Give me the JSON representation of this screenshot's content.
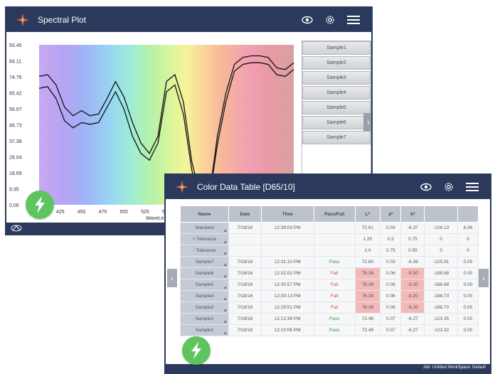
{
  "spectral_window": {
    "title": "Spectral Plot",
    "icons": [
      "eye-icon",
      "gear-icon",
      "menu-icon"
    ],
    "samples": [
      "Sample1",
      "Sample2",
      "Sample3",
      "Sample4",
      "Sample5",
      "Sample6",
      "Sample7"
    ],
    "chart_data": {
      "type": "line",
      "x_ticks": [
        "425",
        "450",
        "475",
        "500",
        "525",
        "5"
      ],
      "y_ticks": [
        "93.45",
        "84.11",
        "74.76",
        "65.42",
        "56.07",
        "46.73",
        "37.38",
        "28.04",
        "18.69",
        "9.35",
        "0.00"
      ],
      "xlabel_partial": "WaveLe",
      "ylim": [
        0,
        93.45
      ],
      "xlim": [
        400,
        700
      ],
      "series": [
        {
          "x": [
            400,
            410,
            420,
            430,
            440,
            450,
            460,
            470,
            480,
            490,
            500,
            510,
            520,
            530,
            540,
            550,
            560,
            570,
            580,
            590,
            600,
            610,
            620,
            630,
            640,
            650,
            660,
            670,
            680,
            690,
            700
          ],
          "values": [
            75,
            76,
            70,
            57,
            52,
            55,
            52,
            53,
            62,
            72,
            63,
            48,
            36,
            30,
            40,
            72,
            76,
            60,
            25,
            5,
            3,
            40,
            65,
            82,
            86,
            87,
            87,
            86,
            80,
            79,
            83
          ]
        },
        {
          "x": [
            400,
            410,
            420,
            430,
            440,
            450,
            460,
            470,
            480,
            490,
            500,
            510,
            520,
            530,
            540,
            550,
            560,
            570,
            580,
            590,
            600,
            610,
            620,
            630,
            640,
            650,
            660,
            670,
            680,
            690,
            700
          ],
          "values": [
            68,
            69,
            62,
            49,
            45,
            48,
            47,
            48,
            57,
            66,
            56,
            40,
            30,
            26,
            36,
            66,
            70,
            53,
            20,
            5,
            2,
            35,
            60,
            78,
            82,
            83,
            83,
            82,
            76,
            75,
            79
          ]
        }
      ]
    },
    "colors": {
      "header": "#2b3a5c",
      "line": "#111111"
    }
  },
  "table_window": {
    "title": "Color Data Table [D65/10]",
    "icons": [
      "eye-icon",
      "gear-icon",
      "menu-icon"
    ],
    "columns": [
      "Name",
      "Date",
      "Time",
      "Pass/Fail",
      "L*",
      "a*",
      "b*",
      "",
      ""
    ],
    "rows": [
      {
        "name": "Standard",
        "date": "7/18/16",
        "time": "12:39:03 PM",
        "pf": "",
        "L": "72.61",
        "a": "0.03",
        "b": "-6.37",
        "c1": "-126.13",
        "c2": "6.99",
        "status": "std"
      },
      {
        "name": "+ Tolerance",
        "date": "",
        "time": "",
        "pf": "",
        "L": "1.25",
        "a": "0.5",
        "b": "0.75",
        "c1": "0",
        "c2": "0",
        "status": "tol"
      },
      {
        "name": "- Tolerance",
        "date": "",
        "time": "",
        "pf": "",
        "L": "1.0",
        "a": "0.75",
        "b": "0.55",
        "c1": "0",
        "c2": "0",
        "status": "tol"
      },
      {
        "name": "Sample7",
        "date": "7/18/16",
        "time": "12:31:10 PM",
        "pf": "Pass",
        "L": "72.60",
        "a": "0.03",
        "b": "-6.36",
        "c1": "-125.91",
        "c2": "0.00",
        "status": "pass"
      },
      {
        "name": "Sample6",
        "date": "7/18/16",
        "time": "12:31:02 PM",
        "pf": "Fail",
        "L": "76.38",
        "a": "0.06",
        "b": "-9.20",
        "c1": "-188.68",
        "c2": "0.00",
        "status": "fail"
      },
      {
        "name": "Sample5",
        "date": "7/18/16",
        "time": "12:30:57 PM",
        "pf": "Fail",
        "L": "76.38",
        "a": "0.06",
        "b": "-9.20",
        "c1": "-188.68",
        "c2": "0.00",
        "status": "fail"
      },
      {
        "name": "Sample4",
        "date": "7/18/16",
        "time": "12:30:13 PM",
        "pf": "Fail",
        "L": "76.38",
        "a": "0.06",
        "b": "-9.20",
        "c1": "-188.73",
        "c2": "0.00",
        "status": "fail"
      },
      {
        "name": "Sample3",
        "date": "7/18/16",
        "time": "12:29:51 PM",
        "pf": "Fail",
        "L": "76.38",
        "a": "0.06",
        "b": "-9.20",
        "c1": "-188.70",
        "c2": "0.00",
        "status": "fail"
      },
      {
        "name": "Sample2",
        "date": "7/18/16",
        "time": "12:12:38 PM",
        "pf": "Pass",
        "L": "72.48",
        "a": "0.07",
        "b": "-6.27",
        "c1": "-123.35",
        "c2": "0.00",
        "status": "pass"
      },
      {
        "name": "Sample1",
        "date": "7/18/16",
        "time": "12:10:06 PM",
        "pf": "Pass",
        "L": "72.49",
        "a": "0.07",
        "b": "-6.27",
        "c1": "-123.32",
        "c2": "0.00",
        "status": "pass"
      }
    ],
    "status_bar": "Job: Untitled  WorkSpace: Default"
  }
}
